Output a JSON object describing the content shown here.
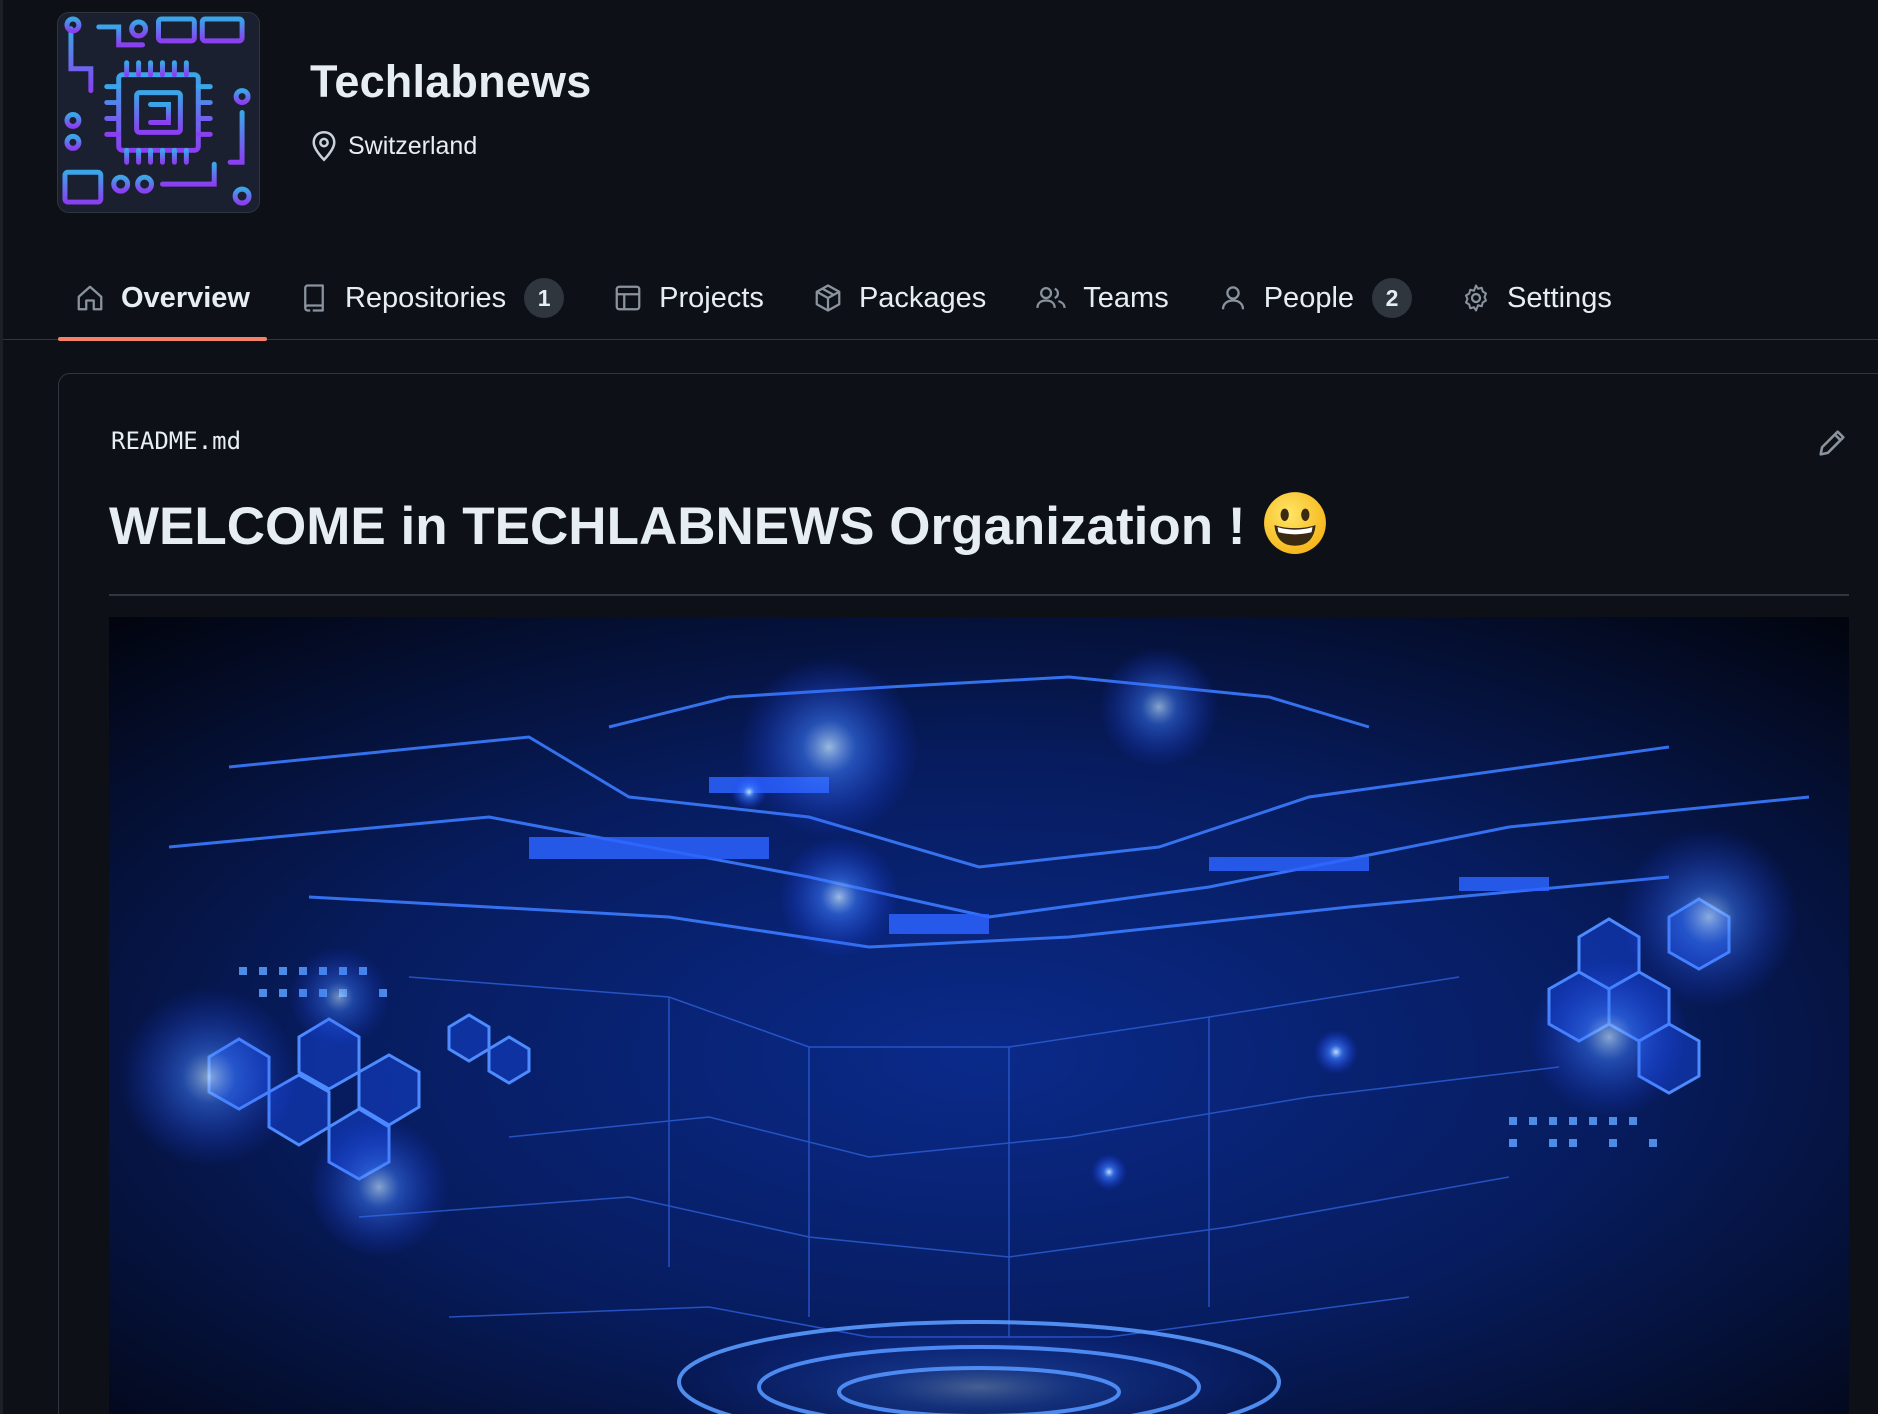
{
  "org": {
    "name": "Techlabnews",
    "location": "Switzerland"
  },
  "nav": {
    "tabs": [
      {
        "label": "Overview",
        "icon": "home-icon",
        "active": true
      },
      {
        "label": "Repositories",
        "icon": "repo-icon",
        "counter": "1"
      },
      {
        "label": "Projects",
        "icon": "table-icon"
      },
      {
        "label": "Packages",
        "icon": "package-icon"
      },
      {
        "label": "Teams",
        "icon": "people-icon"
      },
      {
        "label": "People",
        "icon": "person-icon",
        "counter": "2"
      },
      {
        "label": "Settings",
        "icon": "gear-icon"
      }
    ]
  },
  "readme": {
    "filename": "README.md",
    "heading": "WELCOME in TECHLABNEWS Organization !",
    "heading_emoji": "grinning-face-emoji"
  },
  "colors": {
    "background": "#0d1117",
    "border": "#30363d",
    "text": "#e6edf3",
    "active_tab_underline": "#f78166",
    "counter_bg": "#30363d",
    "banner_accent": "#2f6bff"
  }
}
